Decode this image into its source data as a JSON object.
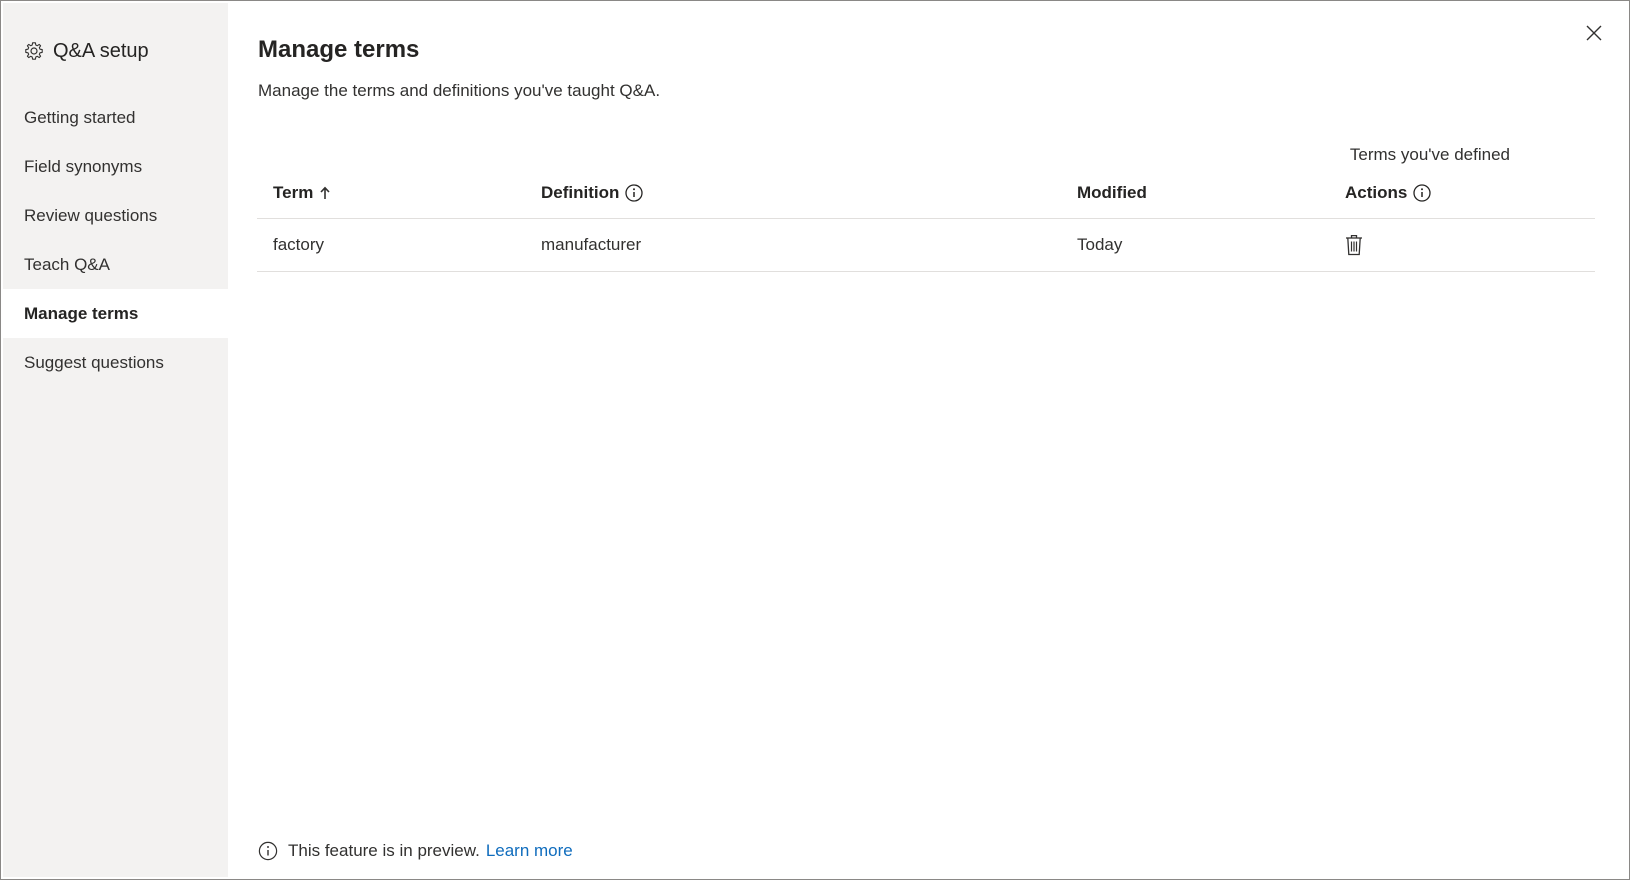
{
  "sidebar": {
    "title": "Q&A setup",
    "title_icon": "gear-icon",
    "items": [
      {
        "label": "Getting started",
        "active": false
      },
      {
        "label": "Field synonyms",
        "active": false
      },
      {
        "label": "Review questions",
        "active": false
      },
      {
        "label": "Teach Q&A",
        "active": false
      },
      {
        "label": "Manage terms",
        "active": true
      },
      {
        "label": "Suggest questions",
        "active": false
      }
    ]
  },
  "main": {
    "title": "Manage terms",
    "subtitle": "Manage the terms and definitions you've taught Q&A.",
    "close_icon": "close-icon",
    "table": {
      "caption": "Terms you've defined",
      "columns": {
        "term": "Term",
        "term_sort_icon": "arrow-up-icon",
        "definition": "Definition",
        "definition_icon": "info-icon",
        "modified": "Modified",
        "actions": "Actions",
        "actions_icon": "info-icon"
      },
      "rows": [
        {
          "term": "factory",
          "definition": "manufacturer",
          "modified": "Today",
          "action_icon": "trash-icon"
        }
      ]
    },
    "footer": {
      "icon": "info-icon",
      "text": "This feature is in preview.",
      "link": "Learn more"
    }
  },
  "colors": {
    "sidebar_bg": "#f3f2f1",
    "link": "#0f6cbd",
    "divider": "#e1dfdd"
  }
}
